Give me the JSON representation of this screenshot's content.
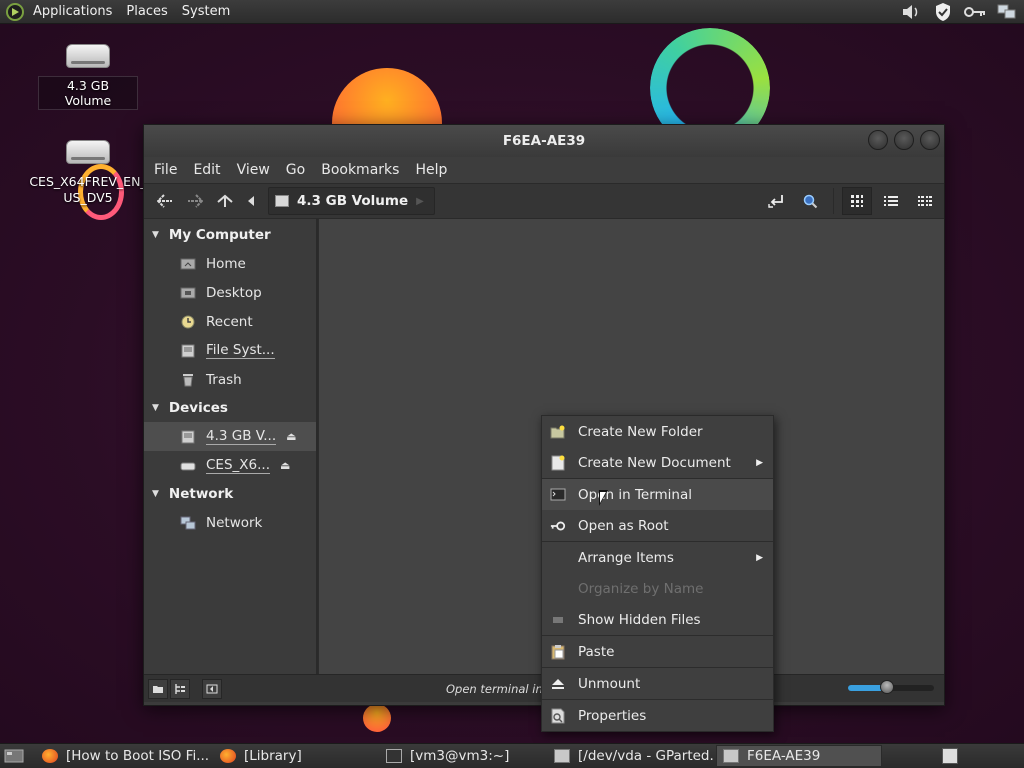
{
  "top_panel": {
    "menus": [
      "Applications",
      "Places",
      "System"
    ],
    "tray_icons": [
      "volume-icon",
      "shield-icon",
      "key-icon",
      "network-icon"
    ]
  },
  "desktop": {
    "icons": [
      {
        "label": "4.3 GB Volume"
      },
      {
        "label": "CES_X64FREV_EN_US_DV5"
      }
    ]
  },
  "window": {
    "title": "F6EA-AE39",
    "menubar": [
      "File",
      "Edit",
      "View",
      "Go",
      "Bookmarks",
      "Help"
    ],
    "location": "4.3 GB Volume",
    "sidebar": {
      "sections": [
        {
          "title": "My Computer",
          "items": [
            {
              "label": "Home",
              "icon": "home-folder-icon"
            },
            {
              "label": "Desktop",
              "icon": "desktop-folder-icon"
            },
            {
              "label": "Recent",
              "icon": "recent-icon"
            },
            {
              "label": "File Syst...",
              "icon": "filesystem-icon"
            },
            {
              "label": "Trash",
              "icon": "trash-icon"
            }
          ]
        },
        {
          "title": "Devices",
          "items": [
            {
              "label": "4.3 GB V...",
              "icon": "drive-icon",
              "selected": true
            },
            {
              "label": "CES_X6...",
              "icon": "drive-icon"
            }
          ]
        },
        {
          "title": "Network",
          "items": [
            {
              "label": "Network",
              "icon": "network-icon"
            }
          ]
        }
      ]
    },
    "status_text": "Open terminal in th",
    "zoom_level": 0.45
  },
  "context_menu": {
    "items": [
      {
        "label": "Create New Folder",
        "icon": "new-folder-icon",
        "enabled": true
      },
      {
        "label": "Create New Document",
        "icon": "new-document-icon",
        "enabled": true,
        "submenu": true
      },
      {
        "label": "Open in Terminal",
        "icon": "terminal-icon",
        "enabled": true,
        "hovered": true
      },
      {
        "label": "Open as Root",
        "icon": "root-key-icon",
        "enabled": true
      },
      {
        "label": "Arrange Items",
        "icon": "",
        "enabled": true,
        "submenu": true
      },
      {
        "label": "Organize by Name",
        "icon": "",
        "enabled": false
      },
      {
        "label": "Show Hidden Files",
        "icon": "checkbox-icon",
        "enabled": true
      },
      {
        "label": "Paste",
        "icon": "paste-icon",
        "enabled": true
      },
      {
        "label": "Unmount",
        "icon": "eject-icon",
        "enabled": true
      },
      {
        "label": "Properties",
        "icon": "properties-icon",
        "enabled": true
      }
    ]
  },
  "taskbar": {
    "tasks": [
      {
        "label": "[How to Boot ISO Fi...",
        "icon": "firefox-icon"
      },
      {
        "label": "[Library]",
        "icon": "firefox-icon"
      },
      {
        "label": "[vm3@vm3:~]",
        "icon": "terminal-icon"
      },
      {
        "label": "[/dev/vda - GParted...",
        "icon": "gparted-icon"
      },
      {
        "label": "F6EA-AE39",
        "icon": "file-manager-icon",
        "active": true
      }
    ]
  },
  "colors": {
    "desktop_bg": "#2b0d25",
    "panel_bg": "#2c2c2c",
    "window_bg": "#3b3b3b",
    "accent": "#3aa0e0"
  }
}
